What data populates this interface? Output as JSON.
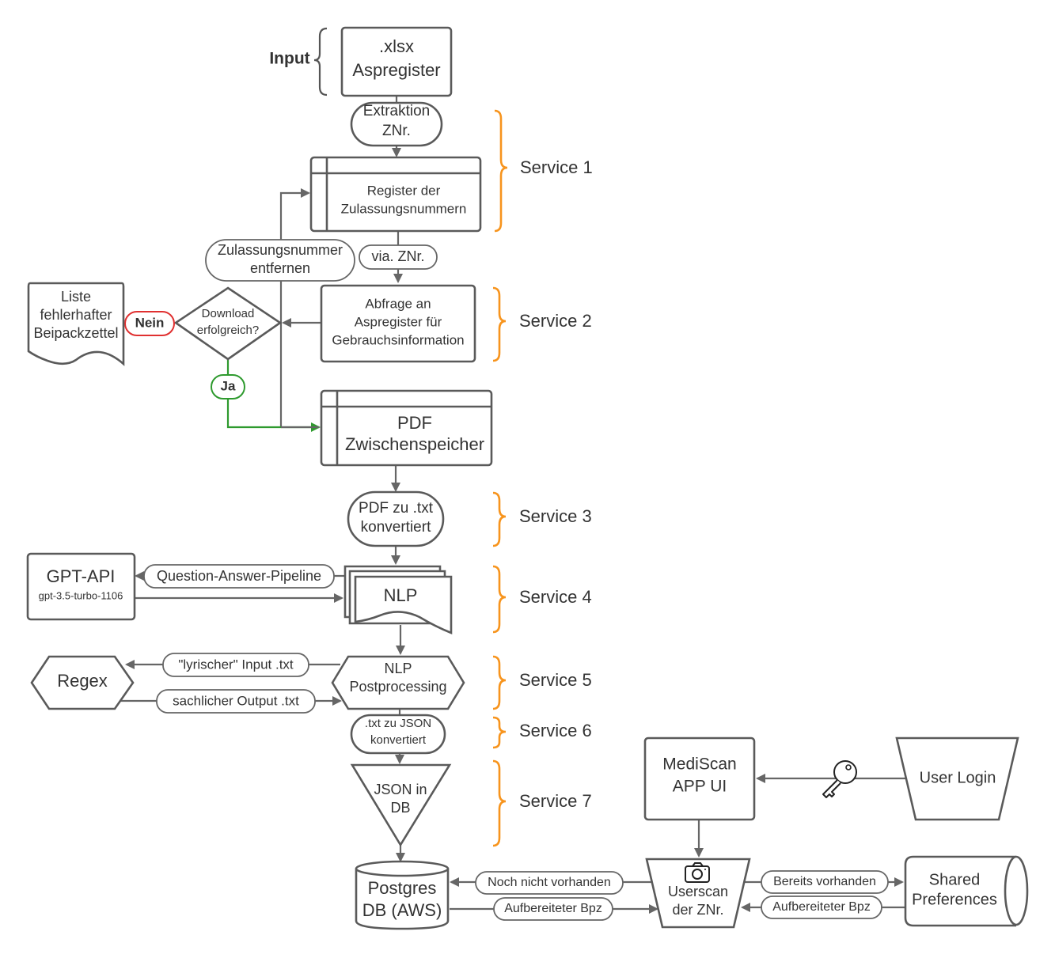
{
  "input_label": "Input",
  "nodes": {
    "xlsx": [
      "'.xlsx",
      "Aspregister"
    ],
    "extraktion": [
      "Extraktion",
      "ZNr."
    ],
    "register": [
      "Register der",
      "Zulassungsnummern"
    ],
    "entfernen": [
      "Zulassungsnummer",
      "entfernen"
    ],
    "via": "via. ZNr.",
    "abfrage": [
      "Abfrage an",
      "Aspregister für",
      "Gebrauchsinformation"
    ],
    "download": [
      "Download",
      "erfolgreich?"
    ],
    "nein": "Nein",
    "ja": "Ja",
    "liste": [
      "Liste",
      "fehlerhafter",
      "Beipackzettel"
    ],
    "pdf": [
      "PDF",
      "Zwischenspeicher"
    ],
    "pdf_txt": [
      "PDF zu .txt",
      "konvertiert"
    ],
    "gpt": [
      "GPT-API",
      "gpt-3.5-turbo-1106"
    ],
    "qa_pipeline": "Question-Answer-Pipeline",
    "nlp": "NLP",
    "nlp_post": [
      "NLP",
      "Postprocessing"
    ],
    "regex": "Regex",
    "lyrischer": "\"lyrischer\" Input .txt",
    "sachlicher": "sachlicher Output .txt",
    "txt_json": [
      ".txt zu JSON",
      "konvertiert"
    ],
    "json_db": [
      "JSON in",
      "DB"
    ],
    "postgres": [
      "Postgres",
      "DB (AWS)"
    ],
    "noch_nicht": "Noch nicht vorhanden",
    "aufbereitet_left": "Aufbereiteter Bpz",
    "userscan": [
      "Userscan",
      "der ZNr."
    ],
    "bereits": "Bereits vorhanden",
    "aufbereitet_right": "Aufbereiteter Bpz",
    "shared": [
      "Shared",
      "Preferences"
    ],
    "mediscan": [
      "MediScan",
      "APP UI"
    ],
    "user_login": "User Login"
  },
  "services": [
    "Service 1",
    "Service 2",
    "Service 3",
    "Service 4",
    "Service 5",
    "Service 6",
    "Service 7"
  ],
  "icons": {
    "key": "key-icon",
    "camera": "camera-icon"
  },
  "colors": {
    "stroke": "#5a5a5a",
    "brace": "#f7941d",
    "nein": "#e03030",
    "ja": "#2e9a2e",
    "text": "#333333"
  }
}
